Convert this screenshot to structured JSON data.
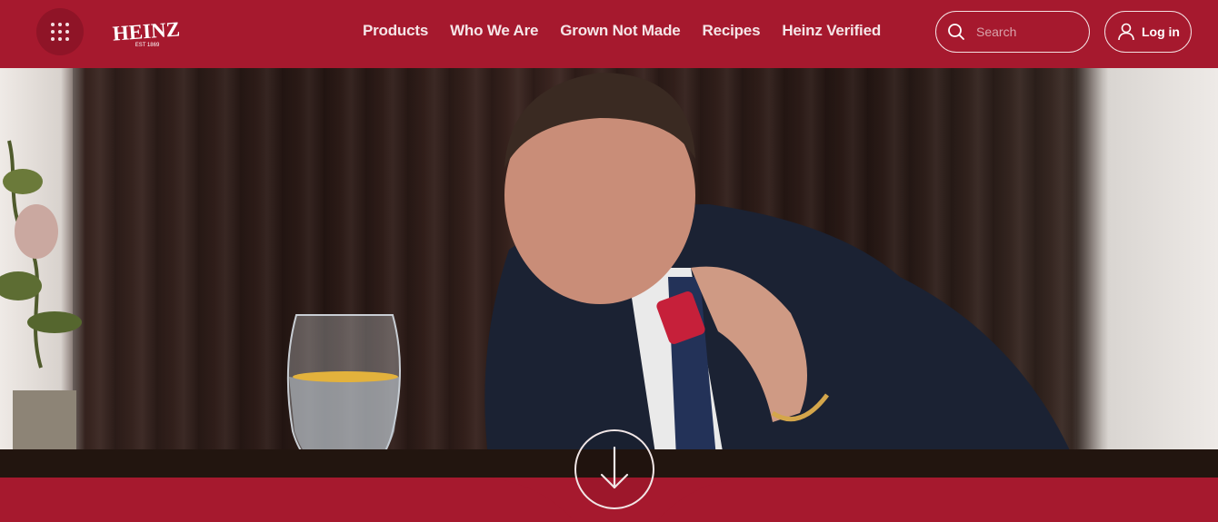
{
  "brand": {
    "logo_text": "HEINZ",
    "logo_sub": "EST 1869",
    "primary_color": "#a6192e"
  },
  "header": {
    "menu_icon": "grid-dots-icon",
    "nav": [
      {
        "label": "Products"
      },
      {
        "label": "Who We Are"
      },
      {
        "label": "Grown Not Made"
      },
      {
        "label": "Recipes"
      },
      {
        "label": "Heinz Verified"
      }
    ],
    "search": {
      "placeholder": "Search",
      "icon": "search-icon"
    },
    "login": {
      "label": "Log in",
      "icon": "user-icon"
    }
  },
  "hero": {
    "scroll_icon": "arrow-down-icon"
  }
}
